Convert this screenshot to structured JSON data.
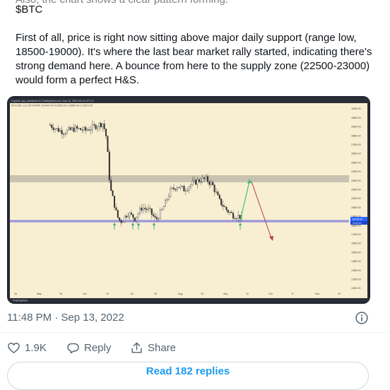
{
  "tweet": {
    "truncated_line": "Also, the chart shows a clear pattern forming.",
    "ticker": "$BTC",
    "body": "First of all, price is right now sitting above major daily support (range low, 18500-19000). It's where the last bear market rally started, indicating there's strong demand here. A bounce from here to the supply zone (22500-23000) would form a perfect H&S."
  },
  "chart": {
    "header_line1": "Cryptoll_ops_published on TradingView.com, Sep 20, 2022 09:10 UTC+2",
    "header_line2": "BTCUSD, 1D, BITSTAMP  O19447.00  H19553.00  L18854.00  C19572.00",
    "price_badge": "18798.00",
    "price_badge_2": "12:22:10",
    "watermark": "TradingView",
    "y_ticks": [
      "31800.00",
      "30800.00",
      "29800.00",
      "28800.00",
      "27800.00",
      "26800.00",
      "25800.00",
      "24800.00",
      "23800.00",
      "22800.00",
      "21800.00",
      "20800.00",
      "19800.00",
      "18800.00",
      "17800.00",
      "16800.00",
      "15800.00",
      "14800.00",
      "13800.00",
      "12800.00",
      "11800.00"
    ],
    "x_ticks": [
      "16",
      "May",
      "16",
      "Jun",
      "13",
      "Jul",
      "18",
      "Aug",
      "15",
      "Sep",
      "12",
      "Oct",
      "17",
      "Nov",
      "14"
    ],
    "colors": {
      "background": "#f8efd2",
      "candle": "#2b2b2b",
      "supply_zone": "#c2bcac",
      "support_line": "#7f7bc9",
      "arrow_up": "#37a37e",
      "arrow_green": "#3fbf7f",
      "arrow_red": "#b43c44"
    }
  },
  "meta": {
    "timestamp": "11:48 PM · Sep 13, 2022"
  },
  "actions": {
    "like_count": "1.9K",
    "reply_label": "Reply",
    "share_label": "Share"
  },
  "replies_button": "Read 182 replies"
}
